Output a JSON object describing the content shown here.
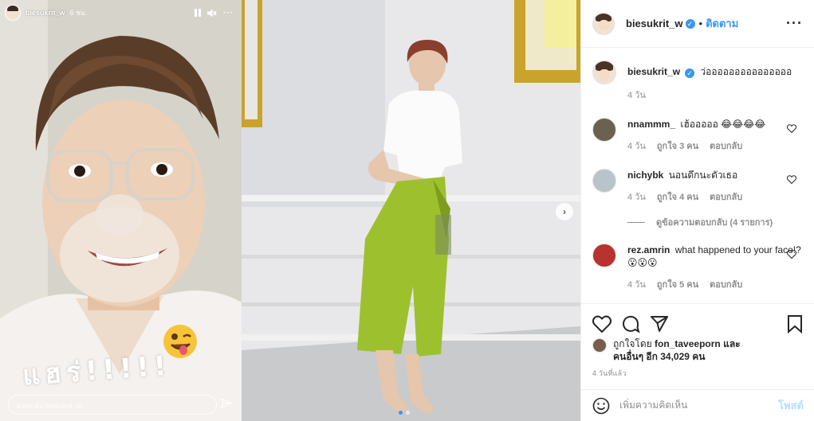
{
  "story": {
    "username": "biesukrit_w",
    "time": "6 ชม.",
    "sticker_text": "แฮร่!!!!!",
    "reply_placeholder": "ตอบกลับ biesukrit_w..."
  },
  "post": {
    "username": "biesukrit_w",
    "follow_label": "ติดตาม",
    "caption_user": "biesukrit_w",
    "caption": "ว่อออออออออออออออ",
    "caption_time": "4 วัน",
    "comments": [
      {
        "user": "nnammm_",
        "text": "เฮ้อออออ 😂😂😂😂",
        "time": "4 วัน",
        "likes": "ถูกใจ 3 คน",
        "reply": "ตอบกลับ"
      },
      {
        "user": "nichybk",
        "text": "นอนดึกนะตัวเธอ",
        "time": "4 วัน",
        "likes": "ถูกใจ 4 คน",
        "reply": "ตอบกลับ",
        "view_replies": "ดูข้อความตอบกลับ (4 รายการ)"
      },
      {
        "user": "rez.amrin",
        "text": "what happened to your face!? 😮😮😮",
        "time": "4 วัน",
        "likes": "ถูกใจ 5 คน",
        "reply": "ตอบกลับ"
      }
    ],
    "liked_by_prefix": "ถูกใจโดย",
    "liked_by_user": "fon_taveeporn",
    "liked_by_and": "และ",
    "liked_by_others": "คนอื่นๆ อีก 34,029 คน",
    "posted_ago": "4 วันที่แล้ว",
    "add_comment_placeholder": "เพิ่มความคิดเห็น",
    "post_button": "โพสต์"
  },
  "colors": {
    "accent": "#3897f0",
    "post_disabled": "#b2dffc"
  }
}
